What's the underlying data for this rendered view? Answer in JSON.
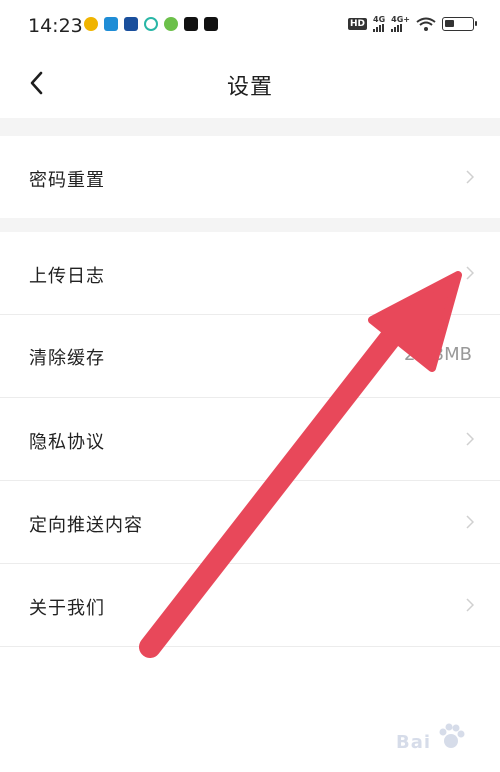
{
  "status_bar": {
    "time": "14:23",
    "app_icons": [
      "weibo-icon",
      "app-icon-blue",
      "app-icon-navy",
      "chat-icon",
      "game-icon",
      "capcut-icon",
      "tiktok-icon"
    ],
    "app_icon_colors": [
      "#f0b400",
      "#1f8dd6",
      "#1a4f9c",
      "#29b6a6",
      "#6cc04a",
      "#111111",
      "#111111"
    ],
    "hd_badge": "HD",
    "network_1": "4G",
    "network_2": "4G+",
    "battery_level": 0.35
  },
  "header": {
    "back_icon": "chevron-left-icon",
    "title": "设置"
  },
  "settings": {
    "group1": [
      {
        "label": "密码重置"
      }
    ],
    "group2": [
      {
        "label": "上传日志"
      },
      {
        "label": "清除缓存",
        "value": "2.03MB"
      },
      {
        "label": "隐私协议"
      },
      {
        "label": "定向推送内容"
      },
      {
        "label": "关于我们"
      }
    ]
  },
  "annotation": {
    "type": "arrow",
    "color": "#e8485a"
  },
  "watermark": {
    "text": "Bai",
    "icon": "baidu-paw-icon"
  }
}
